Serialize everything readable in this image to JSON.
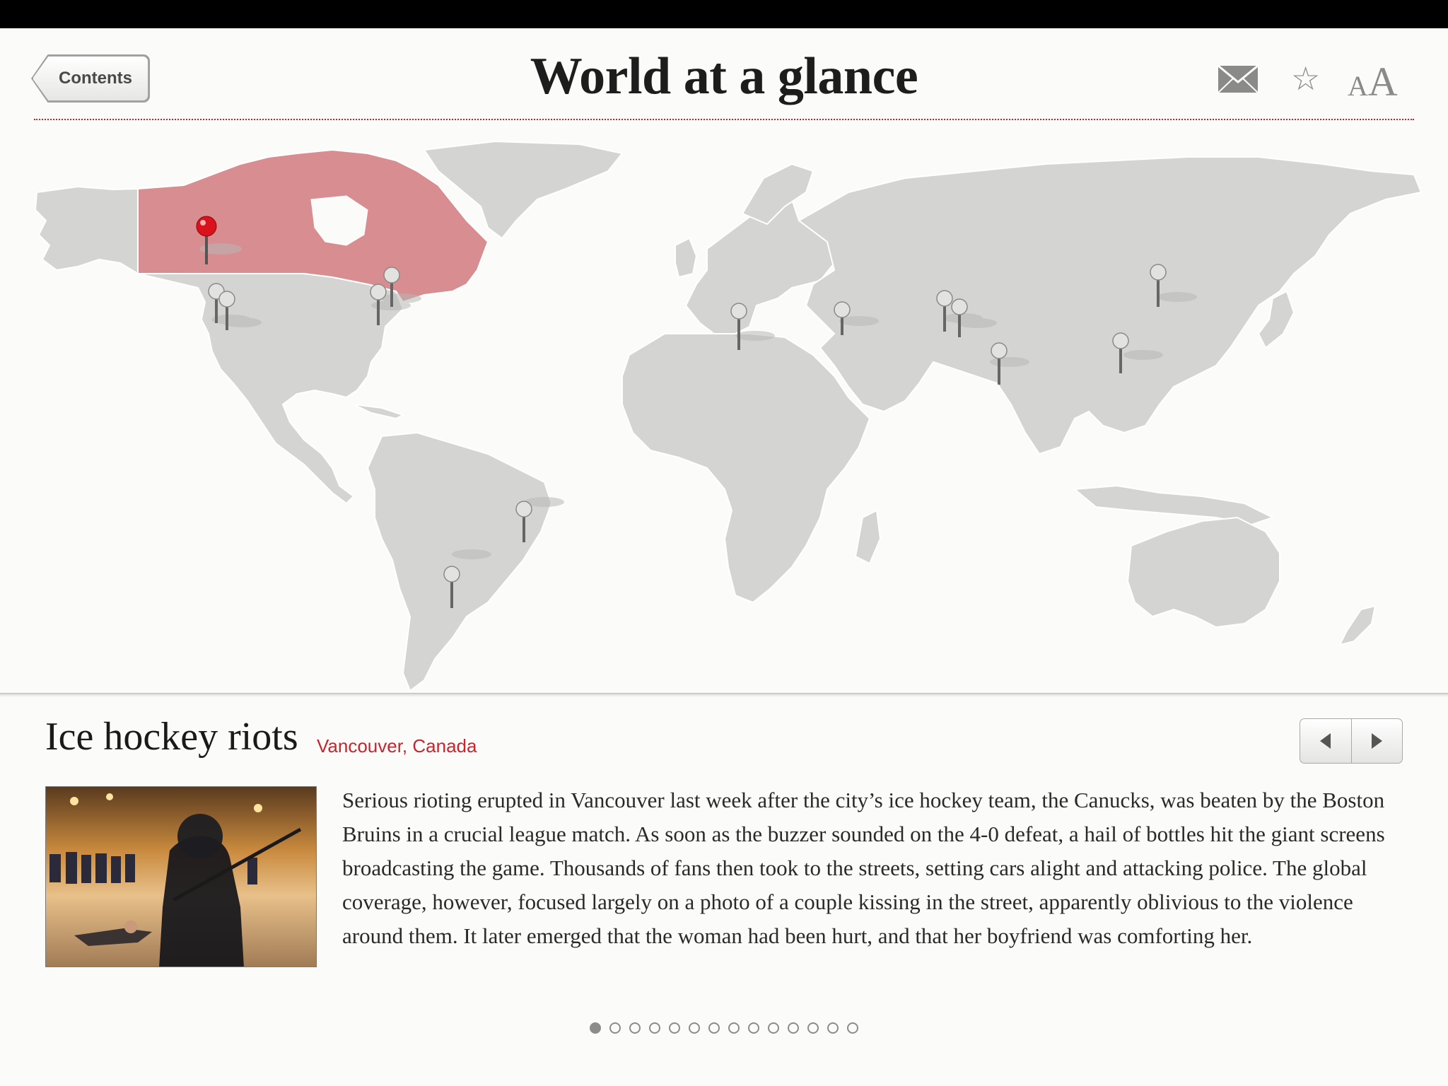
{
  "header": {
    "back_label": "Contents",
    "title": "World at a glance",
    "icons": [
      "mail-icon",
      "star-icon",
      "text-size-icon"
    ],
    "text_size_small": "A",
    "text_size_big": "A"
  },
  "map": {
    "highlight_country": "Canada",
    "colors": {
      "land": "#d4d4d2",
      "highlight": "#d88d90",
      "ocean": "#fbfbf9",
      "border": "#ffffff",
      "active_pin": "#d9121b",
      "pin": "#b8b8b6"
    },
    "pins": [
      {
        "id": "vancouver",
        "active": true
      },
      {
        "id": "us-west-1",
        "active": false
      },
      {
        "id": "us-west-2",
        "active": false
      },
      {
        "id": "us-east-1",
        "active": false
      },
      {
        "id": "us-east-2",
        "active": false
      },
      {
        "id": "libya",
        "active": false
      },
      {
        "id": "syria",
        "active": false
      },
      {
        "id": "pakistan-1",
        "active": false
      },
      {
        "id": "pakistan-2",
        "active": false
      },
      {
        "id": "india",
        "active": false
      },
      {
        "id": "beijing",
        "active": false
      },
      {
        "id": "china-south",
        "active": false
      },
      {
        "id": "brazil",
        "active": false
      },
      {
        "id": "argentina",
        "active": false
      }
    ]
  },
  "story": {
    "title": "Ice hockey riots",
    "location": "Vancouver, Canada",
    "photo_alt_icon": "photo-icon",
    "body": "Serious rioting erupted in Vancouver last week after the city’s ice hockey team, the Canucks, was beaten by the Boston Bruins in a crucial league match. As soon as the buzzer sounded on the 4-0 defeat, a hail of bottles hit the giant screens broadcasting the game. Thousands of fans then took to the streets, setting cars alight and attacking police. The global coverage, however, focused largely on a photo of a couple kissing in the street, apparently oblivious to the violence around them. It later emerged that the woman had been hurt, and that her boyfriend was comforting her."
  },
  "pager": {
    "count": 14,
    "active": 1
  }
}
